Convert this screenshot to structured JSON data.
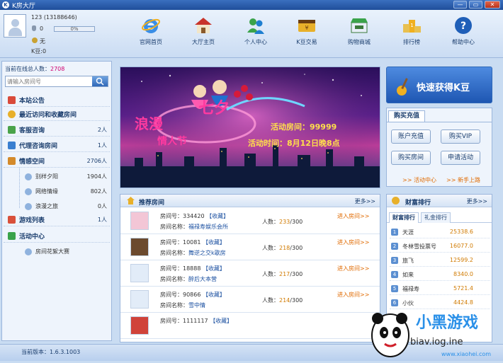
{
  "window": {
    "title": "K房大厅",
    "min": "—",
    "max": "▭",
    "close": "✕"
  },
  "user": {
    "id_line": "123 (13188646)",
    "mic_value": "0",
    "progress": "0%",
    "progress_fraction": 0,
    "coin_label": "无",
    "kdou_label": "K豆:",
    "kdou_value": "0"
  },
  "nav": [
    {
      "label": "官网首页",
      "icon": "ie-browser-icon"
    },
    {
      "label": "大厅主页",
      "icon": "house-icon"
    },
    {
      "label": "个人中心",
      "icon": "users-icon"
    },
    {
      "label": "K豆交易",
      "icon": "wallet-icon"
    },
    {
      "label": "购物商城",
      "icon": "shop-icon"
    },
    {
      "label": "排行榜",
      "icon": "podium-icon"
    },
    {
      "label": "帮助中心",
      "icon": "help-icon"
    }
  ],
  "left": {
    "online_label": "当前在线总人数：",
    "online_count": "2708",
    "search_placeholder": "请输入房间号",
    "items": [
      {
        "label": "本站公告",
        "count": "",
        "color": "#d94a3a"
      },
      {
        "label": "最近访问和收藏房间",
        "count": "",
        "color": "#e8b02a"
      },
      {
        "label": "客服咨询",
        "count": "2人",
        "color": "#4aa34a"
      },
      {
        "label": "代理咨询房间",
        "count": "1人",
        "color": "#3a7fd0"
      },
      {
        "label": "情感空间",
        "count": "2706人",
        "color": "#d48a2a"
      }
    ],
    "sub_items": [
      {
        "label": "别样夕阳",
        "count": "1904人"
      },
      {
        "label": "网络情缘",
        "count": "802人"
      },
      {
        "label": "浪漫之旅",
        "count": "0人"
      }
    ],
    "items2": [
      {
        "label": "游戏列表",
        "count": "1人",
        "color": "#d9503a"
      },
      {
        "label": "活动中心",
        "count": "",
        "color": "#3aa34a"
      }
    ],
    "sub_items2": [
      {
        "label": "房间花絮大赛"
      }
    ]
  },
  "banner": {
    "title1": "浪漫",
    "title2": "七夕",
    "title3": "情人节",
    "line1": "活动房间：99999",
    "line2": "活动时间：8月12日晚8点"
  },
  "rooms": {
    "header": "推荐房间",
    "more": "更多>>",
    "room_no_label": "房间号：",
    "room_name_label": "房间名称：",
    "fav": "【收藏】",
    "people_label": "人数：",
    "enter": "进入房间>>",
    "list": [
      {
        "no": "334420",
        "name": "福禄寿娱乐会所",
        "people": "233",
        "cap": "/300",
        "thumb": "#f3c6d6"
      },
      {
        "no": "10081",
        "name": "舞逆之交k歌房",
        "people": "218",
        "cap": "/300",
        "thumb": "#6b4a2e"
      },
      {
        "no": "18888",
        "name": "醉后大本营",
        "people": "217",
        "cap": "/300",
        "thumb": "#e2ecf8"
      },
      {
        "no": "90866",
        "name": "雪中情",
        "people": "214",
        "cap": "/300",
        "thumb": "#e2ecf8"
      },
      {
        "no": "1111117",
        "name": "",
        "people": "",
        "cap": "",
        "thumb": "#d0433a"
      }
    ]
  },
  "quick": {
    "label": "快速获得K豆"
  },
  "buy": {
    "tab": "购买充值",
    "buttons": [
      "账户充值",
      "购买VIP",
      "购买房间",
      "申请活动"
    ],
    "link1": ">> 活动中心",
    "link2": ">> 新手上路"
  },
  "wealth": {
    "header": "财富排行",
    "more": "更多>>",
    "tab1": "财富排行",
    "tab2": "礼金排行",
    "list": [
      {
        "rank": "1",
        "name": "天涯",
        "value": "25338.6"
      },
      {
        "rank": "2",
        "name": "冬林雪投票号",
        "value": "16077.0"
      },
      {
        "rank": "3",
        "name": "旅飞",
        "value": "12599.2"
      },
      {
        "rank": "4",
        "name": "如来",
        "value": "8340.0"
      },
      {
        "rank": "5",
        "name": "福禄寿",
        "value": "5721.4"
      },
      {
        "rank": "6",
        "name": "小伙",
        "value": "4424.8"
      }
    ]
  },
  "status": {
    "version_label": "当前版本：",
    "version": "1.6.3.1003"
  },
  "watermark": {
    "cn": "小黑游戏",
    "site": "biav.iog.ine",
    "url": "www.xiaohei.com"
  }
}
